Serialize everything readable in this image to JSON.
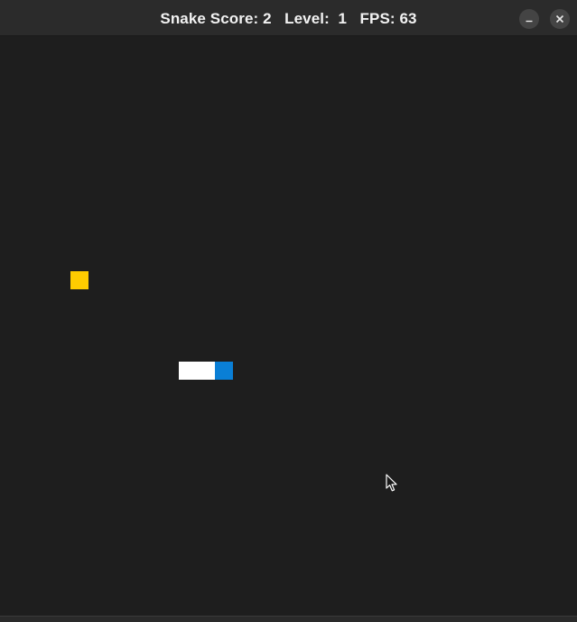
{
  "window": {
    "title": "Snake Score: 2   Level:  1   FPS: 63",
    "controls": {
      "minimize_icon": "minimize-icon",
      "close_icon": "close-icon"
    }
  },
  "game": {
    "score": 2,
    "level": 1,
    "fps": 63,
    "colors": {
      "background": "#1e1e1e",
      "food": "#ffcc00",
      "snake_body": "#ffffff",
      "snake_head": "#0a7fd6"
    }
  }
}
